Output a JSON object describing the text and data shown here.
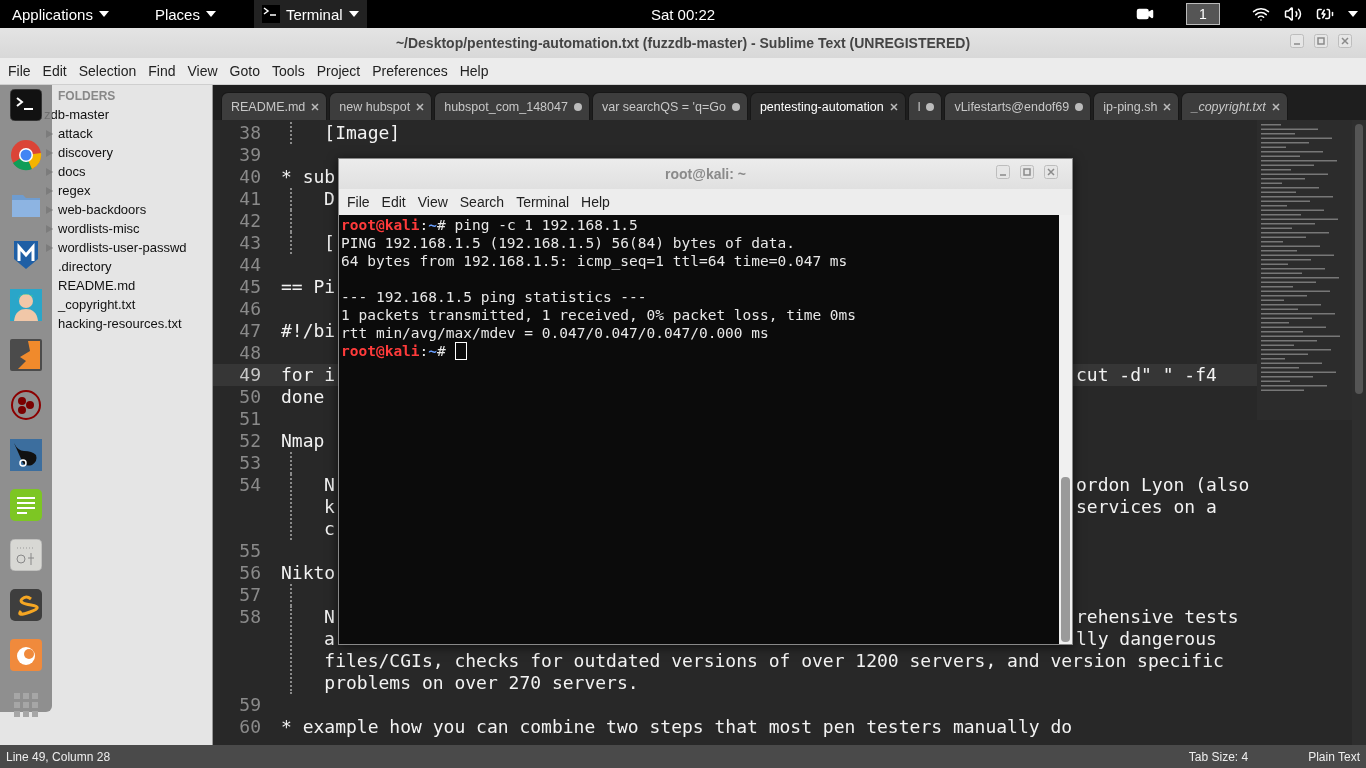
{
  "topbar": {
    "menus": [
      {
        "label": "Applications",
        "kind": "menu"
      },
      {
        "label": "Places",
        "kind": "menu"
      },
      {
        "label": "Terminal",
        "kind": "app"
      }
    ],
    "clock": "Sat 00:22",
    "workspace": "1"
  },
  "window": {
    "title": "~/Desktop/pentesting-automation.txt (fuzzdb-master) - Sublime Text (UNREGISTERED)"
  },
  "menu": [
    "File",
    "Edit",
    "Selection",
    "Find",
    "View",
    "Goto",
    "Tools",
    "Project",
    "Preferences",
    "Help"
  ],
  "sidebar": {
    "header": "FOLDERS",
    "items": [
      {
        "label": "zdb-master",
        "children": [
          {
            "label": "attack",
            "kind": "folder",
            "expanded": false
          },
          {
            "label": "discovery",
            "kind": "folder",
            "expanded": false
          },
          {
            "label": "docs",
            "kind": "folder",
            "expanded": false
          },
          {
            "label": "regex",
            "kind": "folder",
            "expanded": false
          },
          {
            "label": "web-backdoors",
            "kind": "folder",
            "expanded": false
          },
          {
            "label": "wordlists-misc",
            "kind": "folder",
            "expanded": false
          },
          {
            "label": "wordlists-user-passwd",
            "kind": "folder",
            "expanded": false
          },
          {
            "label": ".directory",
            "kind": "file"
          },
          {
            "label": "README.md",
            "kind": "file"
          },
          {
            "label": "_copyright.txt",
            "kind": "file"
          },
          {
            "label": "hacking-resources.txt",
            "kind": "file"
          }
        ]
      }
    ]
  },
  "tabs": [
    {
      "label": "README.md",
      "selected": false,
      "dirty": false,
      "transient": false
    },
    {
      "label": "new hubspot",
      "selected": false,
      "dirty": false,
      "transient": false
    },
    {
      "label": "hubspot_com_148047",
      "selected": false,
      "dirty": true,
      "transient": false
    },
    {
      "label": "var searchQS = 'q=Go",
      "selected": false,
      "dirty": true,
      "transient": false
    },
    {
      "label": "pentesting-automation",
      "selected": true,
      "dirty": false,
      "transient": false
    },
    {
      "label": "l",
      "selected": false,
      "dirty": true,
      "transient": false
    },
    {
      "label": "vLifestarts@endof69",
      "selected": false,
      "dirty": true,
      "transient": false
    },
    {
      "label": "ip-ping.sh",
      "selected": false,
      "dirty": false,
      "transient": false
    },
    {
      "label": "_copyright.txt",
      "selected": false,
      "dirty": false,
      "transient": true
    }
  ],
  "editor": {
    "lines": [
      {
        "number": "38",
        "text": "[Image]",
        "indented": true,
        "current": false
      },
      {
        "number": "39",
        "indented": false,
        "current": false
      },
      {
        "number": "40",
        "rows": [
          {
            "left": "* sub"
          }
        ],
        "indented": false,
        "current": false
      },
      {
        "number": "41",
        "rows": [
          {
            "left": "D"
          }
        ],
        "indented": true,
        "current": false
      },
      {
        "number": "42",
        "indented": true,
        "current": false
      },
      {
        "number": "43",
        "rows": [
          {
            "left": "["
          }
        ],
        "indented": true,
        "current": false
      },
      {
        "number": "44",
        "indented": false,
        "current": false
      },
      {
        "number": "45",
        "rows": [
          {
            "left": "== Pi"
          }
        ],
        "indented": false,
        "current": false
      },
      {
        "number": "46",
        "indented": false,
        "current": false
      },
      {
        "number": "47",
        "rows": [
          {
            "left": "#!/bi"
          }
        ],
        "indented": false,
        "current": false
      },
      {
        "number": "48",
        "indented": false,
        "current": false
      },
      {
        "number": "49",
        "rows": [
          {
            "left": "for i",
            "right": "cut -d\" \" -f4"
          }
        ],
        "indented": false,
        "current": true
      },
      {
        "number": "50",
        "text": "done",
        "indented": false,
        "current": false
      },
      {
        "number": "51",
        "indented": false,
        "current": false
      },
      {
        "number": "52",
        "rows": [
          {
            "left": "Nmap"
          }
        ],
        "indented": false,
        "current": false
      },
      {
        "number": "53",
        "indented": true,
        "current": false
      },
      {
        "number": "54",
        "rows": [
          {
            "left": "N",
            "right": "ordon Lyon (also"
          },
          {
            "left": "k",
            "right": "services on a"
          },
          {
            "left": "c"
          }
        ],
        "indented": true,
        "current": false
      },
      {
        "number": "55",
        "indented": false,
        "current": false
      },
      {
        "number": "56",
        "rows": [
          {
            "left": "Nikto"
          }
        ],
        "indented": false,
        "current": false
      },
      {
        "number": "57",
        "indented": true,
        "current": false
      },
      {
        "number": "58",
        "rows": [
          {
            "left": "N",
            "right": "rehensive tests"
          },
          {
            "left": "a",
            "right": "lly dangerous"
          },
          {
            "text": "files/CGIs, checks for outdated versions of over 1200 servers, and version specific"
          },
          {
            "text": "problems on over 270 servers."
          }
        ],
        "indented": true,
        "current": false
      },
      {
        "number": "59",
        "indented": false,
        "current": false
      },
      {
        "number": "60",
        "text": "* example how you can combine two steps that most pen testers manually do",
        "indented": false,
        "current": false
      }
    ]
  },
  "status_bar": {
    "position": "Line 49, Column 28",
    "tab_size": "Tab Size: 4",
    "syntax": "Plain Text"
  },
  "terminal": {
    "title": "root@kali: ~",
    "menu": [
      "File",
      "Edit",
      "View",
      "Search",
      "Terminal",
      "Help"
    ],
    "lines": [
      {
        "kind": "prompt",
        "user": "root@kali",
        "sep": ":",
        "path": "~",
        "symbol": "#",
        "command": "ping -c 1 192.168.1.5",
        "cursor": false
      },
      {
        "kind": "output",
        "text": "PING 192.168.1.5 (192.168.1.5) 56(84) bytes of data."
      },
      {
        "kind": "output",
        "text": "64 bytes from 192.168.1.5: icmp_seq=1 ttl=64 time=0.047 ms"
      },
      {
        "kind": "blank"
      },
      {
        "kind": "output",
        "text": "--- 192.168.1.5 ping statistics ---"
      },
      {
        "kind": "output",
        "text": "1 packets transmitted, 1 received, 0% packet loss, time 0ms"
      },
      {
        "kind": "output",
        "text": "rtt min/avg/max/mdev = 0.047/0.047/0.047/0.000 ms"
      },
      {
        "kind": "prompt",
        "user": "root@kali",
        "sep": ":",
        "path": "~",
        "symbol": "#",
        "cursor": true
      }
    ]
  }
}
